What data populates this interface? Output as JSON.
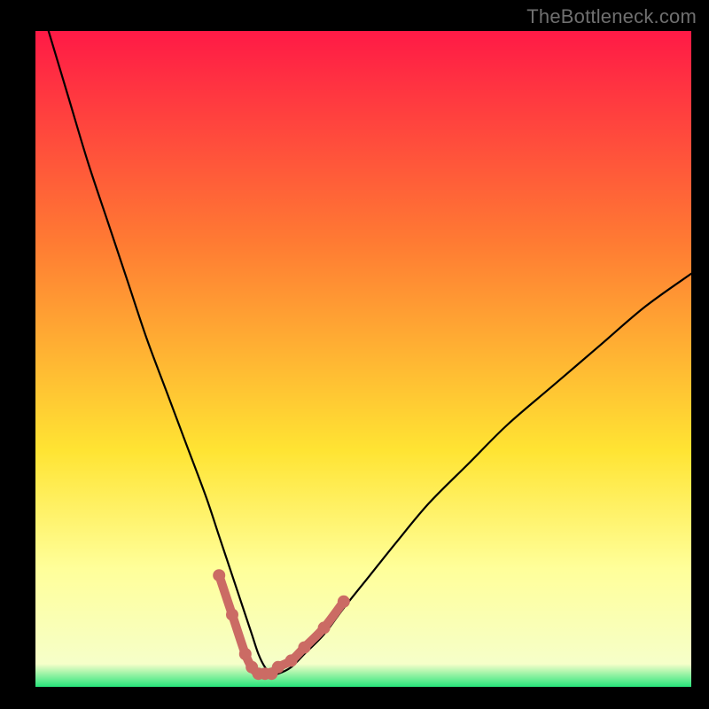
{
  "watermark": "TheBottleneck.com",
  "colors": {
    "bg": "#000000",
    "gradient_top": "#ff1a46",
    "gradient_mid_upper": "#ff7a33",
    "gradient_mid": "#ffe433",
    "gradient_lower": "#ffff9a",
    "gradient_bottom": "#27e47a",
    "curve": "#000000",
    "marker": "#cb6b64"
  },
  "chart_data": {
    "type": "line",
    "title": "",
    "xlabel": "",
    "ylabel": "",
    "xlim": [
      0,
      100
    ],
    "ylim": [
      0,
      100
    ],
    "series": [
      {
        "name": "bottleneck-curve",
        "x": [
          2,
          5,
          8,
          11,
          14,
          17,
          20,
          23,
          26,
          28,
          30,
          32,
          33,
          34,
          35,
          36,
          37,
          39,
          41,
          44,
          47,
          51,
          55,
          60,
          66,
          72,
          79,
          86,
          93,
          100
        ],
        "values": [
          100,
          90,
          80,
          71,
          62,
          53,
          45,
          37,
          29,
          23,
          17,
          11,
          8,
          5,
          3,
          2,
          2,
          3,
          5,
          8,
          12,
          17,
          22,
          28,
          34,
          40,
          46,
          52,
          58,
          63
        ]
      }
    ],
    "markers": {
      "name": "highlighted-points",
      "x": [
        28,
        30,
        32,
        33,
        34,
        35,
        36,
        37,
        39,
        41,
        44,
        47
      ],
      "values": [
        17,
        11,
        5,
        3,
        2,
        2,
        2,
        3,
        4,
        6,
        9,
        13
      ]
    },
    "grid": false,
    "legend": false
  }
}
